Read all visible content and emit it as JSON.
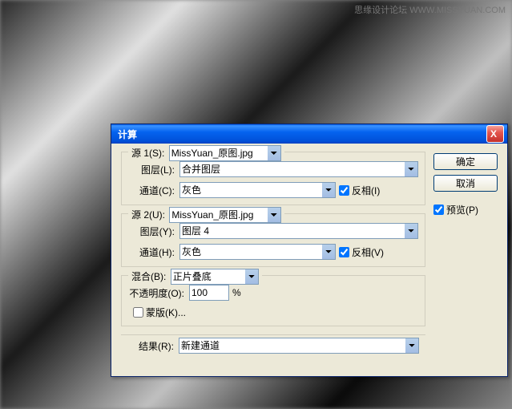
{
  "watermark": "思缘设计论坛  WWW.MISSYUAN.COM",
  "dialog": {
    "title": "计算",
    "close": "X",
    "source1": {
      "label": "源 1(S):",
      "file": "MissYuan_原图.jpg",
      "layer_label": "图层(L):",
      "layer": "合并图层",
      "channel_label": "通道(C):",
      "channel": "灰色",
      "invert_label": "反相(I)",
      "invert": true
    },
    "source2": {
      "label": "源 2(U):",
      "file": "MissYuan_原图.jpg",
      "layer_label": "图层(Y):",
      "layer": "图层 4",
      "channel_label": "通道(H):",
      "channel": "灰色",
      "invert_label": "反相(V)",
      "invert": true
    },
    "blend": {
      "label": "混合(B):",
      "mode": "正片叠底",
      "opacity_label": "不透明度(O):",
      "opacity": "100",
      "opacity_suffix": "%",
      "mask_label": "蒙版(K)...",
      "mask": false
    },
    "result": {
      "label": "结果(R):",
      "value": "新建通道"
    },
    "buttons": {
      "ok": "确定",
      "cancel": "取消",
      "preview_label": "预览(P)",
      "preview": true
    }
  }
}
